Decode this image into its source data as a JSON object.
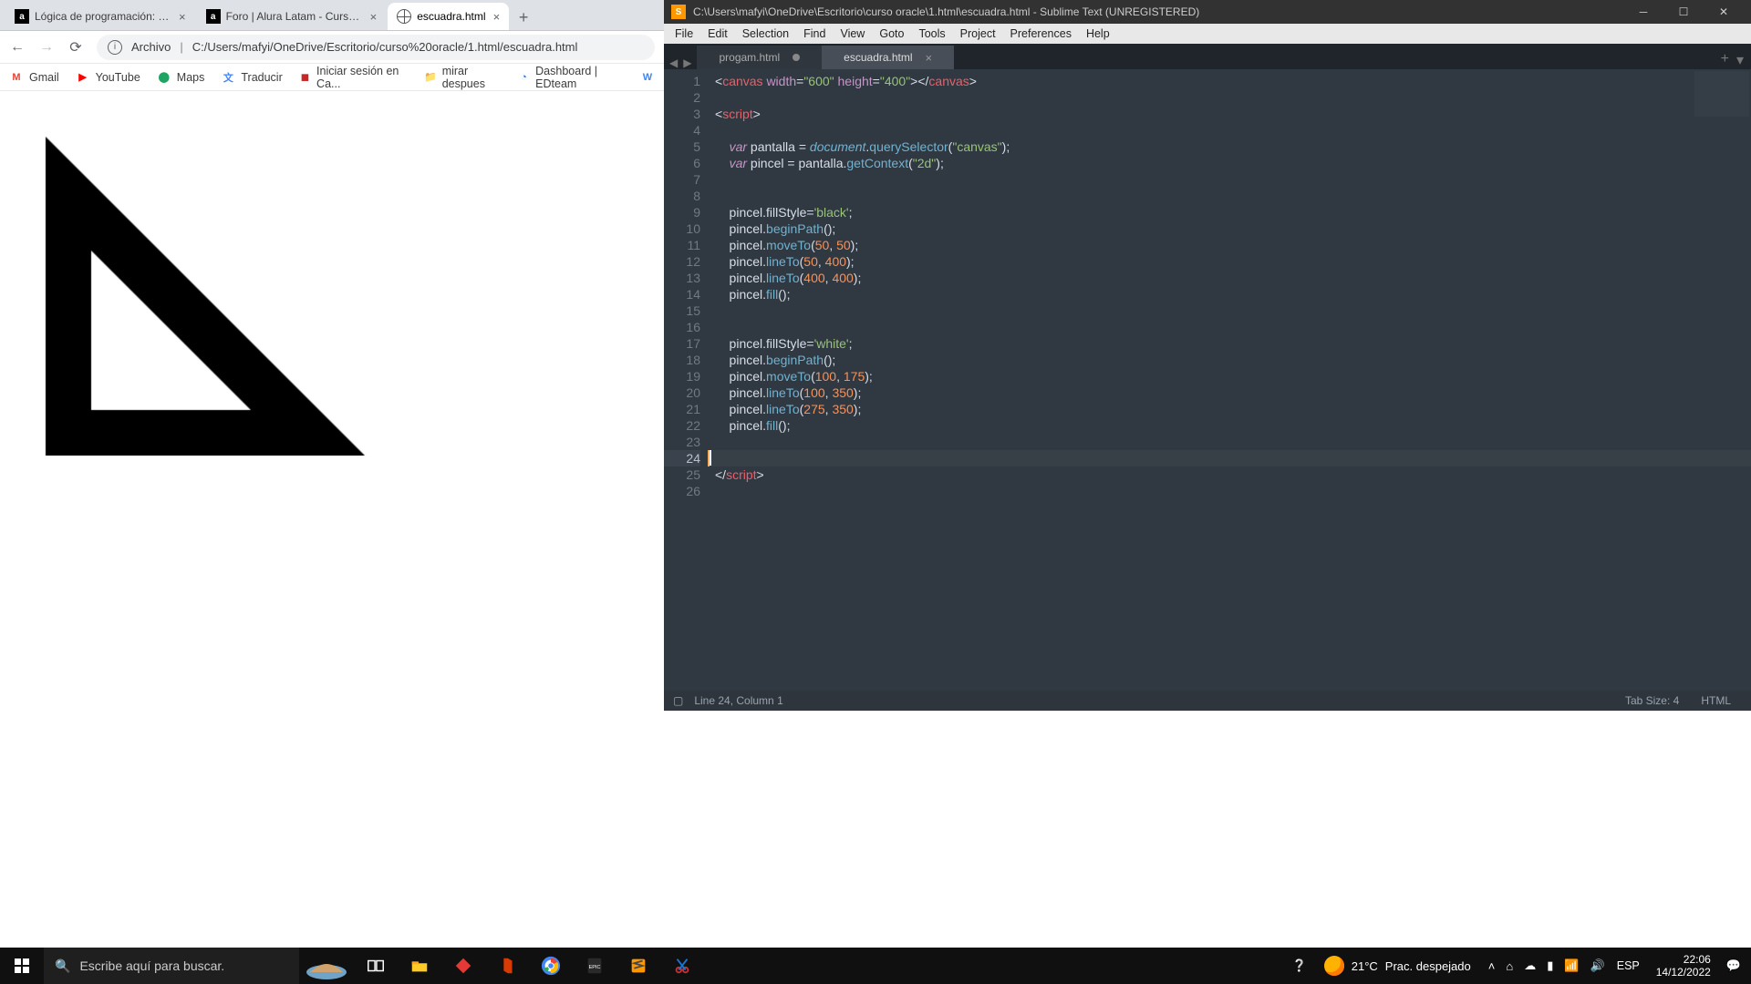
{
  "chrome": {
    "tabs": [
      {
        "title": "Lógica de programación: Practica",
        "fav": "a"
      },
      {
        "title": "Foro | Alura Latam - Cursos onlin",
        "fav": "a"
      },
      {
        "title": "escuadra.html",
        "fav": "globe"
      }
    ],
    "address_prefix": "Archivo",
    "address": "C:/Users/mafyi/OneDrive/Escritorio/curso%20oracle/1.html/escuadra.html",
    "bookmarks": [
      {
        "label": "Gmail",
        "icon": "M",
        "icolor": "#ea4335"
      },
      {
        "label": "YouTube",
        "icon": "▶",
        "icolor": "#ff0000"
      },
      {
        "label": "Maps",
        "icon": "⬤",
        "icolor": "#1fa463"
      },
      {
        "label": "Traducir",
        "icon": "文",
        "icolor": "#4285f4"
      },
      {
        "label": "Iniciar sesión en Ca...",
        "icon": "◼",
        "icolor": "#c62828"
      },
      {
        "label": "mirar despues",
        "icon": "📁",
        "icolor": "#f6ad55"
      },
      {
        "label": "Dashboard | EDteam",
        "icon": "◔",
        "icolor": "#1a73e8"
      }
    ]
  },
  "sublime": {
    "title": "C:\\Users\\mafyi\\OneDrive\\Escritorio\\curso oracle\\1.html\\escuadra.html - Sublime Text (UNREGISTERED)",
    "menu": [
      "File",
      "Edit",
      "Selection",
      "Find",
      "View",
      "Goto",
      "Tools",
      "Project",
      "Preferences",
      "Help"
    ],
    "tabs": [
      {
        "name": "progam.html",
        "dirty": true,
        "active": false
      },
      {
        "name": "escuadra.html",
        "dirty": false,
        "active": true
      }
    ],
    "status": {
      "pos": "Line 24, Column 1",
      "tabsize": "Tab Size: 4",
      "lang": "HTML"
    },
    "cursor_line": 24,
    "code_lines": [
      {
        "n": 1,
        "seg": [
          [
            "c-p",
            "<"
          ],
          [
            "c-tag",
            "canvas"
          ],
          [
            "c-p",
            " "
          ],
          [
            "c-attr",
            "width"
          ],
          [
            "c-p",
            "="
          ],
          [
            "c-str",
            "\"600\""
          ],
          [
            "c-p",
            " "
          ],
          [
            "c-attr",
            "height"
          ],
          [
            "c-p",
            "="
          ],
          [
            "c-str",
            "\"400\""
          ],
          [
            "c-p",
            "></"
          ],
          [
            "c-tag",
            "canvas"
          ],
          [
            "c-p",
            ">"
          ]
        ]
      },
      {
        "n": 2,
        "seg": []
      },
      {
        "n": 3,
        "seg": [
          [
            "c-p",
            "<"
          ],
          [
            "c-tag",
            "script"
          ],
          [
            "c-p",
            ">"
          ]
        ]
      },
      {
        "n": 4,
        "seg": []
      },
      {
        "n": 5,
        "seg": [
          [
            "c-p",
            "    "
          ],
          [
            "c-kw",
            "var"
          ],
          [
            "c-p",
            " pantalla = "
          ],
          [
            "c-obj",
            "document"
          ],
          [
            "c-p",
            "."
          ],
          [
            "c-fn",
            "querySelector"
          ],
          [
            "c-p",
            "("
          ],
          [
            "c-str",
            "\"canvas\""
          ],
          [
            "c-p",
            ");"
          ]
        ]
      },
      {
        "n": 6,
        "seg": [
          [
            "c-p",
            "    "
          ],
          [
            "c-kw",
            "var"
          ],
          [
            "c-p",
            " pincel = pantalla."
          ],
          [
            "c-fn",
            "getContext"
          ],
          [
            "c-p",
            "("
          ],
          [
            "c-str",
            "\"2d\""
          ],
          [
            "c-p",
            ");"
          ]
        ]
      },
      {
        "n": 7,
        "seg": []
      },
      {
        "n": 8,
        "seg": []
      },
      {
        "n": 9,
        "seg": [
          [
            "c-p",
            "    pincel.fillStyle="
          ],
          [
            "c-str",
            "'black'"
          ],
          [
            "c-p",
            ";"
          ]
        ]
      },
      {
        "n": 10,
        "seg": [
          [
            "c-p",
            "    pincel."
          ],
          [
            "c-fn",
            "beginPath"
          ],
          [
            "c-p",
            "();"
          ]
        ]
      },
      {
        "n": 11,
        "seg": [
          [
            "c-p",
            "    pincel."
          ],
          [
            "c-fn",
            "moveTo"
          ],
          [
            "c-p",
            "("
          ],
          [
            "c-num",
            "50"
          ],
          [
            "c-p",
            ", "
          ],
          [
            "c-num",
            "50"
          ],
          [
            "c-p",
            ");"
          ]
        ]
      },
      {
        "n": 12,
        "seg": [
          [
            "c-p",
            "    pincel."
          ],
          [
            "c-fn",
            "lineTo"
          ],
          [
            "c-p",
            "("
          ],
          [
            "c-num",
            "50"
          ],
          [
            "c-p",
            ", "
          ],
          [
            "c-num",
            "400"
          ],
          [
            "c-p",
            ");"
          ]
        ]
      },
      {
        "n": 13,
        "seg": [
          [
            "c-p",
            "    pincel."
          ],
          [
            "c-fn",
            "lineTo"
          ],
          [
            "c-p",
            "("
          ],
          [
            "c-num",
            "400"
          ],
          [
            "c-p",
            ", "
          ],
          [
            "c-num",
            "400"
          ],
          [
            "c-p",
            ");"
          ]
        ]
      },
      {
        "n": 14,
        "seg": [
          [
            "c-p",
            "    pincel."
          ],
          [
            "c-fn",
            "fill"
          ],
          [
            "c-p",
            "();"
          ]
        ]
      },
      {
        "n": 15,
        "seg": []
      },
      {
        "n": 16,
        "seg": []
      },
      {
        "n": 17,
        "seg": [
          [
            "c-p",
            "    pincel.fillStyle="
          ],
          [
            "c-str",
            "'white'"
          ],
          [
            "c-p",
            ";"
          ]
        ]
      },
      {
        "n": 18,
        "seg": [
          [
            "c-p",
            "    pincel."
          ],
          [
            "c-fn",
            "beginPath"
          ],
          [
            "c-p",
            "();"
          ]
        ]
      },
      {
        "n": 19,
        "seg": [
          [
            "c-p",
            "    pincel."
          ],
          [
            "c-fn",
            "moveTo"
          ],
          [
            "c-p",
            "("
          ],
          [
            "c-num",
            "100"
          ],
          [
            "c-p",
            ", "
          ],
          [
            "c-num",
            "175"
          ],
          [
            "c-p",
            ");"
          ]
        ]
      },
      {
        "n": 20,
        "seg": [
          [
            "c-p",
            "    pincel."
          ],
          [
            "c-fn",
            "lineTo"
          ],
          [
            "c-p",
            "("
          ],
          [
            "c-num",
            "100"
          ],
          [
            "c-p",
            ", "
          ],
          [
            "c-num",
            "350"
          ],
          [
            "c-p",
            ");"
          ]
        ]
      },
      {
        "n": 21,
        "seg": [
          [
            "c-p",
            "    pincel."
          ],
          [
            "c-fn",
            "lineTo"
          ],
          [
            "c-p",
            "("
          ],
          [
            "c-num",
            "275"
          ],
          [
            "c-p",
            ", "
          ],
          [
            "c-num",
            "350"
          ],
          [
            "c-p",
            ");"
          ]
        ]
      },
      {
        "n": 22,
        "seg": [
          [
            "c-p",
            "    pincel."
          ],
          [
            "c-fn",
            "fill"
          ],
          [
            "c-p",
            "();"
          ]
        ]
      },
      {
        "n": 23,
        "seg": []
      },
      {
        "n": 24,
        "seg": []
      },
      {
        "n": 25,
        "seg": [
          [
            "c-p",
            "</"
          ],
          [
            "c-sl",
            "script"
          ],
          [
            "c-p",
            ">"
          ]
        ]
      },
      {
        "n": 26,
        "seg": []
      }
    ]
  },
  "taskbar": {
    "search_placeholder": "Escribe aquí para buscar.",
    "weather_temp": "21°C",
    "weather_text": "Prac. despejado",
    "lang": "ESP",
    "time": "22:06",
    "date": "14/12/2022"
  }
}
